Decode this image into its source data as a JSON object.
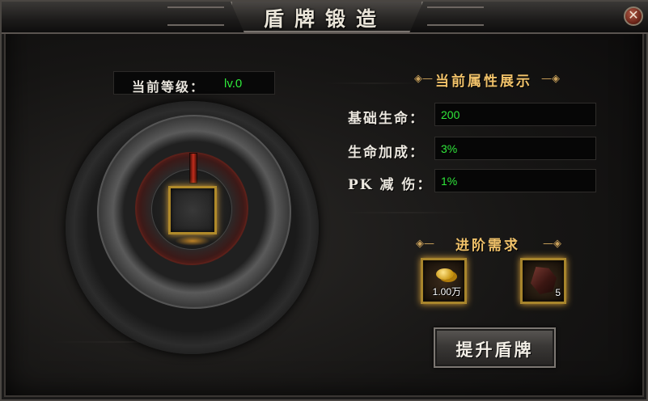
{
  "window": {
    "title": "盾牌锻造",
    "close_icon": "close-icon"
  },
  "level": {
    "label": "当前等级：",
    "value": "lv.0"
  },
  "attributes": {
    "title": "当前属性展示",
    "items": [
      {
        "label": "基础生命：",
        "value": "200"
      },
      {
        "label": "生命加成：",
        "value": "3%"
      },
      {
        "label": "PK 减 伤：",
        "value": "1%"
      }
    ]
  },
  "requirements": {
    "title": "进阶需求",
    "items": [
      {
        "icon": "gold-coin-icon",
        "count": "1.00万"
      },
      {
        "icon": "ore-stone-icon",
        "count": "5"
      }
    ]
  },
  "upgrade_button": {
    "label": "提升盾牌"
  },
  "colors": {
    "value_green": "#2fe83a",
    "section_gold": "#f1c26a",
    "slot_gold": "#b08a2a"
  }
}
